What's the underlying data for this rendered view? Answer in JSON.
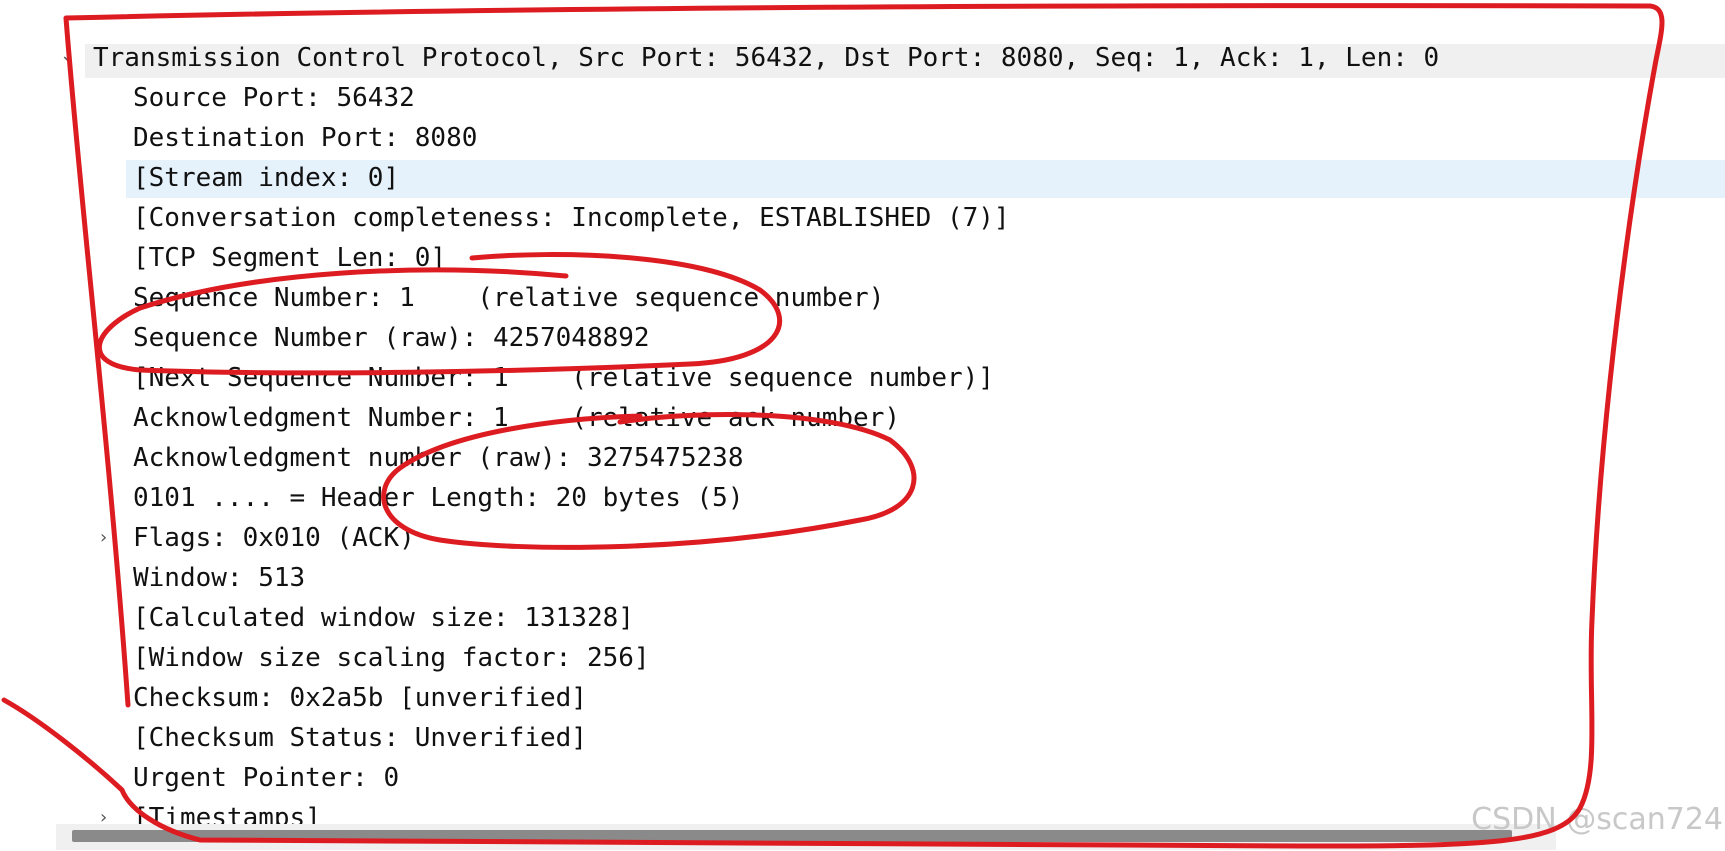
{
  "tree": {
    "header": {
      "label": "Transmission Control Protocol, Src Port: 56432, Dst Port: 8080, Seq: 1, Ack: 1, Len: 0",
      "expander": "⌄"
    },
    "fields": [
      {
        "label": "Source Port: 56432"
      },
      {
        "label": "Destination Port: 8080"
      },
      {
        "label": "[Stream index: 0]"
      },
      {
        "label": "[Conversation completeness: Incomplete, ESTABLISHED (7)]"
      },
      {
        "label": "[TCP Segment Len: 0]"
      },
      {
        "label": "Sequence Number: 1    (relative sequence number)"
      },
      {
        "label": "Sequence Number (raw): 4257048892"
      },
      {
        "label": "[Next Sequence Number: 1    (relative sequence number)]"
      },
      {
        "label": "Acknowledgment Number: 1    (relative ack number)"
      },
      {
        "label": "Acknowledgment number (raw): 3275475238"
      },
      {
        "label": "0101 .... = Header Length: 20 bytes (5)"
      },
      {
        "label": "Flags: 0x010 (ACK)",
        "expander": "›"
      },
      {
        "label": "Window: 513"
      },
      {
        "label": "[Calculated window size: 131328]"
      },
      {
        "label": "[Window size scaling factor: 256]"
      },
      {
        "label": "Checksum: 0x2a5b [unverified]"
      },
      {
        "label": "[Checksum Status: Unverified]"
      },
      {
        "label": "Urgent Pointer: 0"
      },
      {
        "label": "[Timestamps]",
        "expander": "›"
      }
    ]
  },
  "watermark": "CSDN @scan724",
  "colors": {
    "annotation": "#dd1c22",
    "selection": "#e5f1fb",
    "header_bg": "#f0f0f0",
    "text": "#111111"
  }
}
